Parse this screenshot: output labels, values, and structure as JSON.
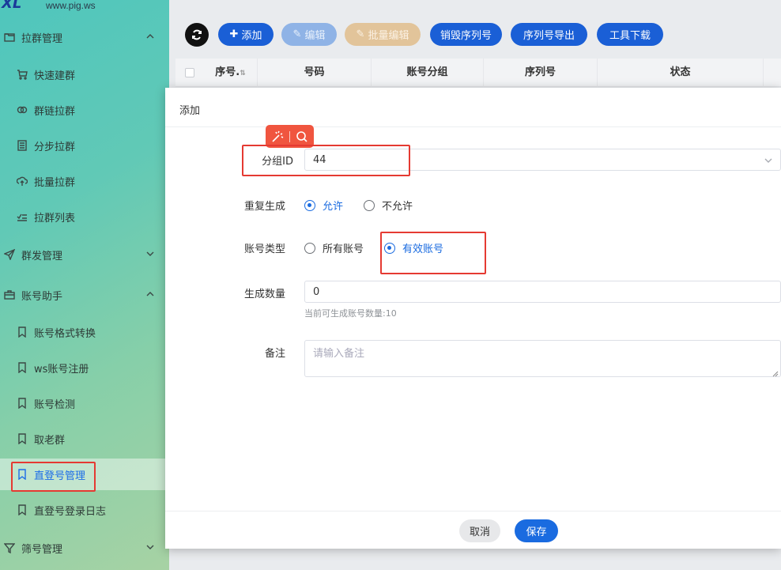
{
  "logo": {
    "text": "www.pig.ws"
  },
  "sidebar": {
    "groups": [
      {
        "label": "拉群管理",
        "icon": "folder-icon",
        "expanded": true
      },
      {
        "label": "群发管理",
        "icon": "send-icon",
        "expanded": false
      },
      {
        "label": "账号助手",
        "icon": "briefcase-icon",
        "expanded": true
      },
      {
        "label": "筛号管理",
        "icon": "filter-icon",
        "expanded": false
      }
    ],
    "items": [
      {
        "label": "快速建群",
        "icon": "cart-icon"
      },
      {
        "label": "群链拉群",
        "icon": "link-icon"
      },
      {
        "label": "分步拉群",
        "icon": "list-icon"
      },
      {
        "label": "批量拉群",
        "icon": "cloud-upload-icon"
      },
      {
        "label": "拉群列表",
        "icon": "checklist-icon"
      },
      {
        "label": "账号格式转换",
        "icon": "bookmark-icon"
      },
      {
        "label": "ws账号注册",
        "icon": "bookmark-icon"
      },
      {
        "label": "账号检测",
        "icon": "bookmark-icon"
      },
      {
        "label": "取老群",
        "icon": "bookmark-icon"
      },
      {
        "label": "直登号管理",
        "icon": "bookmark-icon",
        "active": true
      },
      {
        "label": "直登号登录日志",
        "icon": "bookmark-icon"
      }
    ]
  },
  "toolbar": {
    "add": "添加",
    "edit": "编辑",
    "batch_edit": "批量编辑",
    "destroy_serial": "销毁序列号",
    "export_serial": "序列号导出",
    "tool_download": "工具下载"
  },
  "table": {
    "columns": [
      "序号.",
      "号码",
      "账号分组",
      "序列号",
      "状态"
    ]
  },
  "modal": {
    "title": "添加",
    "group_id": {
      "label": "分组ID",
      "value": "44"
    },
    "repeat": {
      "label": "重复生成",
      "options": [
        "允许",
        "不允许"
      ],
      "selected": "允许"
    },
    "account_type": {
      "label": "账号类型",
      "options": [
        "所有账号",
        "有效账号"
      ],
      "selected": "有效账号"
    },
    "count": {
      "label": "生成数量",
      "value": "0",
      "hint": "当前可生成账号数量:10"
    },
    "remark": {
      "label": "备注",
      "placeholder": "请输入备注"
    },
    "cancel": "取消",
    "save": "保存"
  },
  "colors": {
    "primary": "#1a5fd6",
    "accent_red": "#e53a32"
  }
}
